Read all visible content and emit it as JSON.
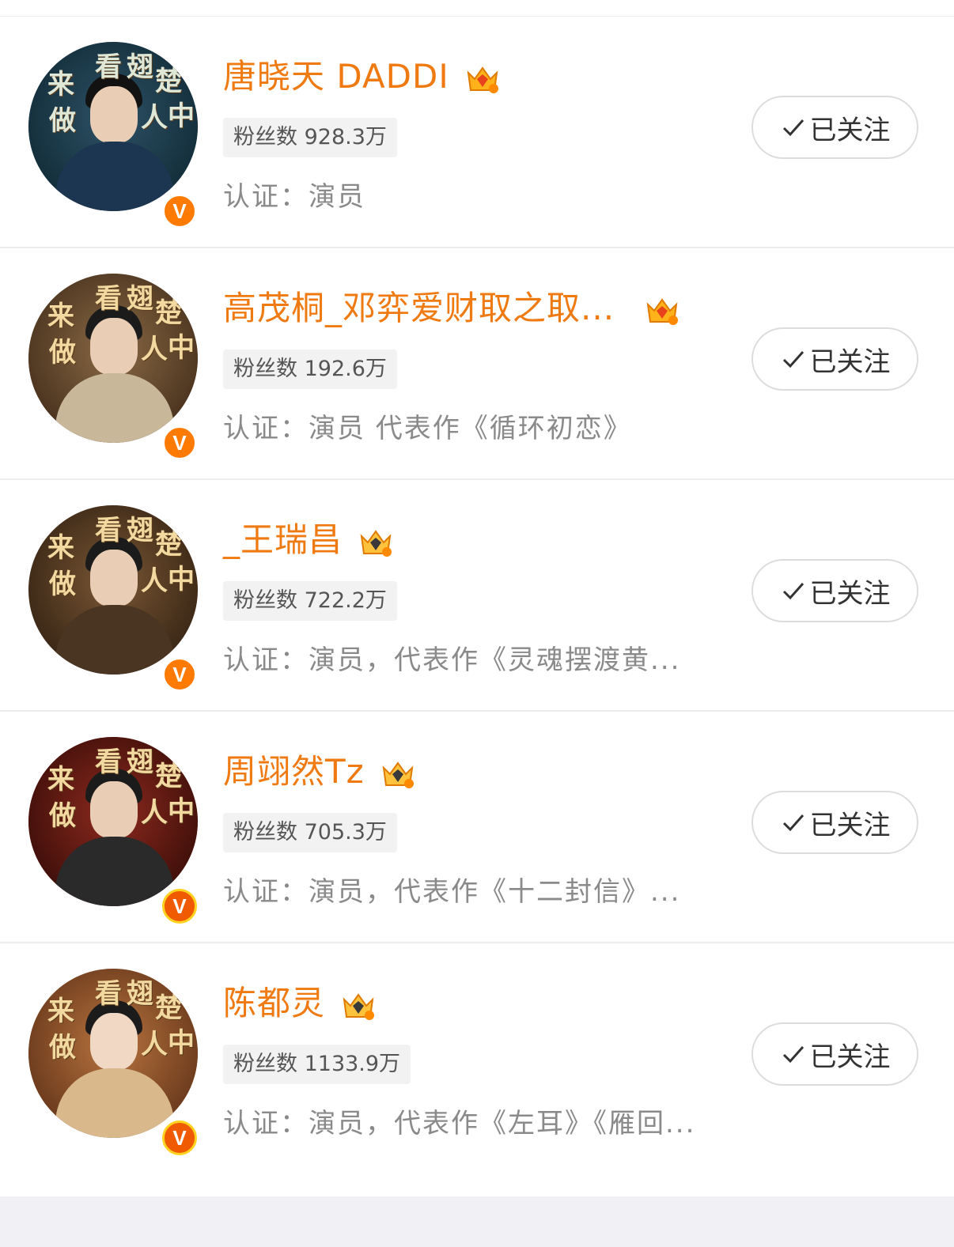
{
  "colors": {
    "name": "#f07a12",
    "verified_badge": "#ff7a00",
    "verified_badge_gold_ring": "#ffd21f",
    "muted_text": "#8a8a8a",
    "fans_bg": "#f2f2f2",
    "divider": "#ececec",
    "footer_bg": "#f1f1f5"
  },
  "users": [
    {
      "name": "唐晓天 DADDI",
      "crown_icon": "crown-level-7-icon",
      "fans": "粉丝数 928.3万",
      "cert": "认证：演员",
      "follow_label": "已关注",
      "badge_style": "orange"
    },
    {
      "name": "高茂桐_邓弈爱财取之取...",
      "crown_icon": "crown-level-6-icon",
      "fans": "粉丝数 192.6万",
      "cert": "认证：演员 代表作《循环初恋》",
      "follow_label": "已关注",
      "badge_style": "orange"
    },
    {
      "name": "_王瑞昌",
      "crown_icon": "crown-level-9-icon",
      "fans": "粉丝数 722.2万",
      "cert": "认证：演员，代表作《灵魂摆渡黄...",
      "follow_label": "已关注",
      "badge_style": "orange"
    },
    {
      "name": "周翊然Tz",
      "crown_icon": "crown-level-8-icon",
      "fans": "粉丝数 705.3万",
      "cert": "认证：演员，代表作《十二封信》...",
      "follow_label": "已关注",
      "badge_style": "gold"
    },
    {
      "name": "陈都灵",
      "crown_icon": "crown-level-9-icon",
      "fans": "粉丝数 1133.9万",
      "cert": "认证：演员，代表作《左耳》《雁回...",
      "follow_label": "已关注",
      "badge_style": "gold"
    }
  ],
  "avatar_overlay_text": [
    "来",
    "看",
    "翅",
    "楚",
    "做",
    "人",
    "中",
    "翅",
    "楚"
  ],
  "verified_glyph": "V"
}
